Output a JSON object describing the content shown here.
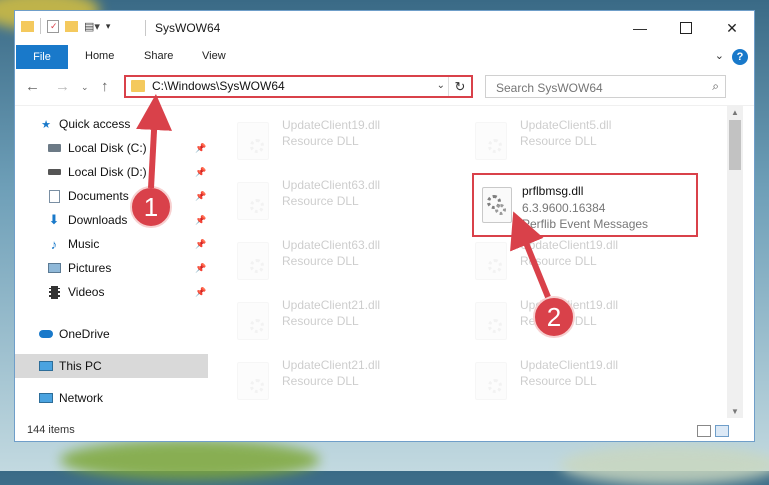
{
  "window": {
    "title": "SysWOW64"
  },
  "ribbon": {
    "tabs": [
      "File",
      "Home",
      "Share",
      "View"
    ],
    "help_label": "?"
  },
  "address": {
    "path": "C:\\Windows\\SysWOW64",
    "search_placeholder": "Search SysWOW64"
  },
  "sidebar": {
    "items": [
      {
        "label": "Quick access",
        "icon": "star-icon",
        "pinned": false
      },
      {
        "label": "Local Disk (C:)",
        "icon": "drive-icon",
        "pinned": true
      },
      {
        "label": "Local Disk (D:)",
        "icon": "drive-icon",
        "pinned": true
      },
      {
        "label": "Documents",
        "icon": "documents-icon",
        "pinned": true
      },
      {
        "label": "Downloads",
        "icon": "download-icon",
        "pinned": true
      },
      {
        "label": "Music",
        "icon": "music-icon",
        "pinned": true
      },
      {
        "label": "Pictures",
        "icon": "pictures-icon",
        "pinned": true
      },
      {
        "label": "Videos",
        "icon": "videos-icon",
        "pinned": true
      },
      {
        "label": "OneDrive",
        "icon": "cloud-icon",
        "pinned": false
      },
      {
        "label": "This PC",
        "icon": "computer-icon",
        "pinned": false,
        "selected": true
      },
      {
        "label": "Network",
        "icon": "network-icon",
        "pinned": false
      }
    ]
  },
  "files": [
    {
      "name": "UpdateClient19.dll",
      "desc": "Resource DLL"
    },
    {
      "name": "UpdateClient5.dll",
      "desc": "Resource DLL"
    },
    {
      "name": "UpdateClient63.dll",
      "desc": "Resource DLL"
    },
    {
      "name": "UpdateClient63.dll",
      "desc": "Resource DLL"
    },
    {
      "name": "UpdateClient19.dll",
      "desc": "Resource DLL"
    },
    {
      "name": "UpdateClient21.dll",
      "desc": "Resource DLL"
    },
    {
      "name": "UpdateClient19.dll",
      "desc": "Resource DLL"
    },
    {
      "name": "UpdateClient21.dll",
      "desc": "Resource DLL"
    },
    {
      "name": "UpdateClient19.dll",
      "desc": "Resource DLL"
    }
  ],
  "highlighted_file": {
    "name": "prflbmsg.dll",
    "version": "6.3.9600.16384",
    "desc": "Perflib Event Messages"
  },
  "status": {
    "item_count": "144 items"
  },
  "callouts": {
    "one": "1",
    "two": "2"
  },
  "colors": {
    "accent": "#1979ca",
    "highlight": "#d9414a"
  }
}
